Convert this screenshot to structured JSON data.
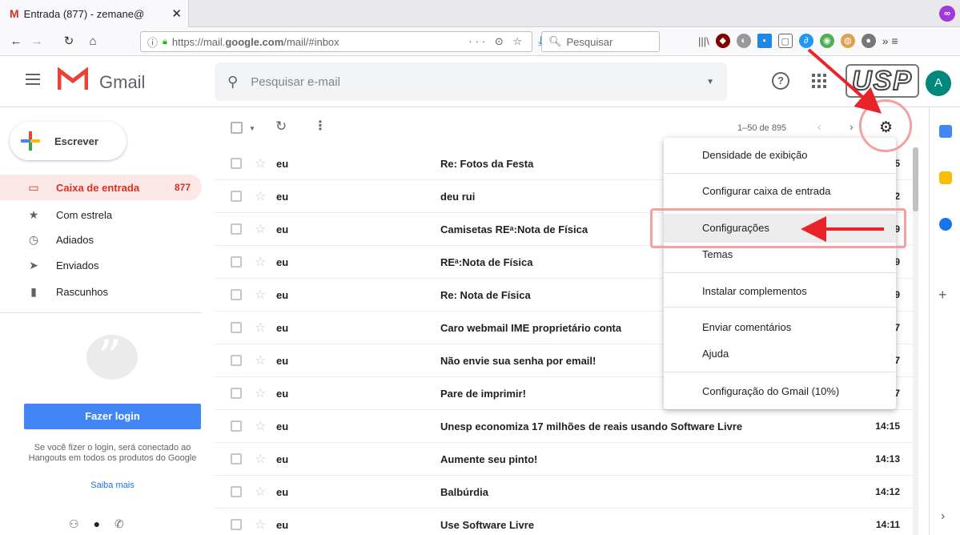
{
  "browser": {
    "tab_title": "Entrada (877) - zemane@",
    "tab_icon_glyph": "M",
    "url_prefix": "https://mail.",
    "url_host": "google.com",
    "url_path": "/mail/#inbox",
    "url_tools": "··· ⊙ ☆",
    "search_placeholder": "Pesquisar",
    "toolbar_right": "»  ≡"
  },
  "gmail": {
    "logo_text": "Gmail",
    "search_placeholder": "Pesquisar e-mail",
    "help_glyph": "?",
    "badge_text": "USP",
    "avatar_letter": "A"
  },
  "nav": {
    "compose_label": "Escrever",
    "items": [
      {
        "label": "Caixa de entrada",
        "count": "877",
        "icon": "▭"
      },
      {
        "label": "Com estrela",
        "count": "",
        "icon": "★"
      },
      {
        "label": "Adiados",
        "count": "",
        "icon": "◷"
      },
      {
        "label": "Enviados",
        "count": "",
        "icon": "➤"
      },
      {
        "label": "Rascunhos",
        "count": "",
        "icon": "▮"
      }
    ],
    "login_button": "Fazer login",
    "login_desc": "Se você fizer o login, será conectado ao Hangouts em todos os produtos do Google",
    "login_link": "Saiba mais"
  },
  "list": {
    "pager": "1–50 de 895",
    "rows": [
      {
        "from": "eu",
        "subject": "Re: Fotos da Festa",
        "time": "5"
      },
      {
        "from": "eu",
        "subject": "deu rui",
        "time": "2"
      },
      {
        "from": "eu",
        "subject": "Camisetas REᵃ:Nota de Física",
        "time": "9"
      },
      {
        "from": "eu",
        "subject": "REᵃ:Nota de Física",
        "time": "9"
      },
      {
        "from": "eu",
        "subject": "Re: Nota de Física",
        "time": "9"
      },
      {
        "from": "eu",
        "subject": "Caro webmail IME proprietário conta",
        "time": "7"
      },
      {
        "from": "eu",
        "subject": "Não envie sua senha por email!",
        "time": "7"
      },
      {
        "from": "eu",
        "subject": "Pare de imprimir!",
        "time": "7"
      },
      {
        "from": "eu",
        "subject": "Unesp economiza 17 milhões de reais usando Software Livre",
        "time": "14:15"
      },
      {
        "from": "eu",
        "subject": "Aumente seu pinto!",
        "time": "14:13"
      },
      {
        "from": "eu",
        "subject": "Balbúrdia",
        "time": "14:12"
      },
      {
        "from": "eu",
        "subject": "Use Software Livre",
        "time": "14:11"
      }
    ]
  },
  "settings_menu": {
    "items": [
      "Densidade de exibição",
      "Configurar caixa de entrada",
      "Configurações",
      "Temas",
      "Instalar complementos",
      "Enviar comentários",
      "Ajuda",
      "Configuração do Gmail (10%)"
    ]
  },
  "colors": {
    "gmail_red": "#d93025",
    "annotation_red": "#e8242a",
    "annotation_pink": "#f4a0a0",
    "login_blue": "#4285f4",
    "avatar_teal": "#00897b"
  }
}
